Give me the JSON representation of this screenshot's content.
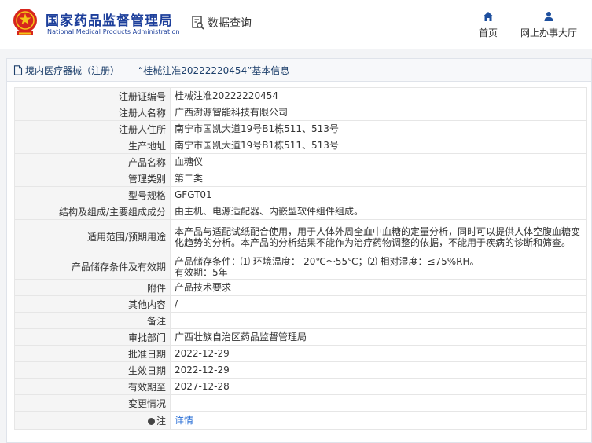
{
  "header": {
    "title_cn": "国家药品监督管理局",
    "title_en": "National Medical Products Administration",
    "query_label": "数据查询",
    "nav": [
      {
        "label": "首页",
        "icon": "home-icon"
      },
      {
        "label": "网上办事大厅",
        "icon": "person-icon"
      }
    ]
  },
  "colors": {
    "brand_blue": "#1d3f9b",
    "emblem_red": "#d7261d",
    "link_blue": "#2a6fd6",
    "label_bg": "#f5f5f5"
  },
  "panel": {
    "title": "境内医疗器械（注册）——“桂械注准20222220454”基本信息"
  },
  "record": [
    {
      "label": "注册证编号",
      "value": "桂械注准20222220454"
    },
    {
      "label": "注册人名称",
      "value": "广西澍源智能科技有限公司"
    },
    {
      "label": "注册人住所",
      "value": "南宁市国凯大道19号B1栋511、513号"
    },
    {
      "label": "生产地址",
      "value": "南宁市国凯大道19号B1栋511、513号"
    },
    {
      "label": "产品名称",
      "value": "血糖仪"
    },
    {
      "label": "管理类别",
      "value": "第二类"
    },
    {
      "label": "型号规格",
      "value": "GFGT01"
    },
    {
      "label": "结构及组成/主要组成成分",
      "value": "由主机、电源适配器、内嵌型软件组件组成。"
    },
    {
      "label": "适用范围/预期用途",
      "value": "本产品与适配试纸配合使用，用于人体外周全血中血糖的定量分析，同时可以提供人体空腹血糖变化趋势的分析。本产品的分析结果不能作为治疗药物调整的依据，不能用于疾病的诊断和筛查。"
    },
    {
      "label": "产品储存条件及有效期",
      "value_line1": "产品储存条件：⑴ 环境温度：-20℃～55℃；⑵ 相对湿度：≤75%RH。",
      "value_line2": "有效期：5年"
    },
    {
      "label": "附件",
      "value": "产品技术要求"
    },
    {
      "label": "其他内容",
      "value": "/"
    },
    {
      "label": "备注",
      "value": ""
    },
    {
      "label": "审批部门",
      "value": "广西壮族自治区药品监督管理局"
    },
    {
      "label": "批准日期",
      "value": "2022-12-29"
    },
    {
      "label": "生效日期",
      "value": "2022-12-29"
    },
    {
      "label": "有效期至",
      "value": "2027-12-28"
    },
    {
      "label": "变更情况",
      "value": ""
    },
    {
      "label": "注",
      "value": "详情"
    }
  ]
}
